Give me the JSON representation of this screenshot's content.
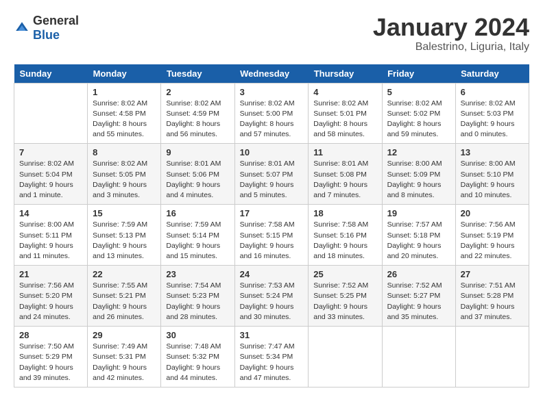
{
  "logo": {
    "general": "General",
    "blue": "Blue"
  },
  "title": "January 2024",
  "subtitle": "Balestrino, Liguria, Italy",
  "days_header": [
    "Sunday",
    "Monday",
    "Tuesday",
    "Wednesday",
    "Thursday",
    "Friday",
    "Saturday"
  ],
  "weeks": [
    [
      {
        "day": "",
        "info": ""
      },
      {
        "day": "1",
        "info": "Sunrise: 8:02 AM\nSunset: 4:58 PM\nDaylight: 8 hours\nand 55 minutes."
      },
      {
        "day": "2",
        "info": "Sunrise: 8:02 AM\nSunset: 4:59 PM\nDaylight: 8 hours\nand 56 minutes."
      },
      {
        "day": "3",
        "info": "Sunrise: 8:02 AM\nSunset: 5:00 PM\nDaylight: 8 hours\nand 57 minutes."
      },
      {
        "day": "4",
        "info": "Sunrise: 8:02 AM\nSunset: 5:01 PM\nDaylight: 8 hours\nand 58 minutes."
      },
      {
        "day": "5",
        "info": "Sunrise: 8:02 AM\nSunset: 5:02 PM\nDaylight: 8 hours\nand 59 minutes."
      },
      {
        "day": "6",
        "info": "Sunrise: 8:02 AM\nSunset: 5:03 PM\nDaylight: 9 hours\nand 0 minutes."
      }
    ],
    [
      {
        "day": "7",
        "info": "Sunrise: 8:02 AM\nSunset: 5:04 PM\nDaylight: 9 hours\nand 1 minute."
      },
      {
        "day": "8",
        "info": "Sunrise: 8:02 AM\nSunset: 5:05 PM\nDaylight: 9 hours\nand 3 minutes."
      },
      {
        "day": "9",
        "info": "Sunrise: 8:01 AM\nSunset: 5:06 PM\nDaylight: 9 hours\nand 4 minutes."
      },
      {
        "day": "10",
        "info": "Sunrise: 8:01 AM\nSunset: 5:07 PM\nDaylight: 9 hours\nand 5 minutes."
      },
      {
        "day": "11",
        "info": "Sunrise: 8:01 AM\nSunset: 5:08 PM\nDaylight: 9 hours\nand 7 minutes."
      },
      {
        "day": "12",
        "info": "Sunrise: 8:00 AM\nSunset: 5:09 PM\nDaylight: 9 hours\nand 8 minutes."
      },
      {
        "day": "13",
        "info": "Sunrise: 8:00 AM\nSunset: 5:10 PM\nDaylight: 9 hours\nand 10 minutes."
      }
    ],
    [
      {
        "day": "14",
        "info": "Sunrise: 8:00 AM\nSunset: 5:11 PM\nDaylight: 9 hours\nand 11 minutes."
      },
      {
        "day": "15",
        "info": "Sunrise: 7:59 AM\nSunset: 5:13 PM\nDaylight: 9 hours\nand 13 minutes."
      },
      {
        "day": "16",
        "info": "Sunrise: 7:59 AM\nSunset: 5:14 PM\nDaylight: 9 hours\nand 15 minutes."
      },
      {
        "day": "17",
        "info": "Sunrise: 7:58 AM\nSunset: 5:15 PM\nDaylight: 9 hours\nand 16 minutes."
      },
      {
        "day": "18",
        "info": "Sunrise: 7:58 AM\nSunset: 5:16 PM\nDaylight: 9 hours\nand 18 minutes."
      },
      {
        "day": "19",
        "info": "Sunrise: 7:57 AM\nSunset: 5:18 PM\nDaylight: 9 hours\nand 20 minutes."
      },
      {
        "day": "20",
        "info": "Sunrise: 7:56 AM\nSunset: 5:19 PM\nDaylight: 9 hours\nand 22 minutes."
      }
    ],
    [
      {
        "day": "21",
        "info": "Sunrise: 7:56 AM\nSunset: 5:20 PM\nDaylight: 9 hours\nand 24 minutes."
      },
      {
        "day": "22",
        "info": "Sunrise: 7:55 AM\nSunset: 5:21 PM\nDaylight: 9 hours\nand 26 minutes."
      },
      {
        "day": "23",
        "info": "Sunrise: 7:54 AM\nSunset: 5:23 PM\nDaylight: 9 hours\nand 28 minutes."
      },
      {
        "day": "24",
        "info": "Sunrise: 7:53 AM\nSunset: 5:24 PM\nDaylight: 9 hours\nand 30 minutes."
      },
      {
        "day": "25",
        "info": "Sunrise: 7:52 AM\nSunset: 5:25 PM\nDaylight: 9 hours\nand 33 minutes."
      },
      {
        "day": "26",
        "info": "Sunrise: 7:52 AM\nSunset: 5:27 PM\nDaylight: 9 hours\nand 35 minutes."
      },
      {
        "day": "27",
        "info": "Sunrise: 7:51 AM\nSunset: 5:28 PM\nDaylight: 9 hours\nand 37 minutes."
      }
    ],
    [
      {
        "day": "28",
        "info": "Sunrise: 7:50 AM\nSunset: 5:29 PM\nDaylight: 9 hours\nand 39 minutes."
      },
      {
        "day": "29",
        "info": "Sunrise: 7:49 AM\nSunset: 5:31 PM\nDaylight: 9 hours\nand 42 minutes."
      },
      {
        "day": "30",
        "info": "Sunrise: 7:48 AM\nSunset: 5:32 PM\nDaylight: 9 hours\nand 44 minutes."
      },
      {
        "day": "31",
        "info": "Sunrise: 7:47 AM\nSunset: 5:34 PM\nDaylight: 9 hours\nand 47 minutes."
      },
      {
        "day": "",
        "info": ""
      },
      {
        "day": "",
        "info": ""
      },
      {
        "day": "",
        "info": ""
      }
    ]
  ]
}
